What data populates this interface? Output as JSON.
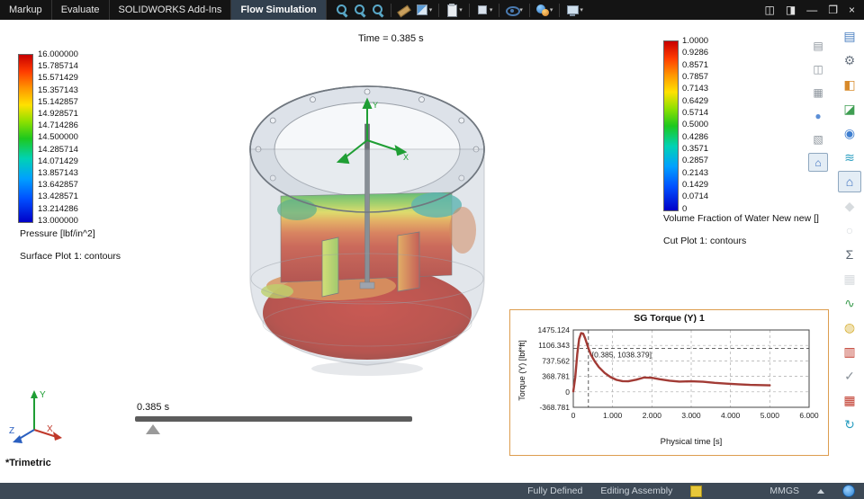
{
  "ribbon": {
    "tabs": [
      "Markup",
      "Evaluate",
      "SOLIDWORKS Add-Ins",
      "Flow Simulation"
    ],
    "active_tab": "Flow Simulation",
    "icons": [
      {
        "name": "zoom-to-fit-icon",
        "shape": "magnifier"
      },
      {
        "name": "zoom-to-area-icon",
        "shape": "magnifier"
      },
      {
        "name": "zoom-in-out-icon",
        "shape": "magnifier"
      },
      {
        "name": "sep"
      },
      {
        "name": "measure-icon",
        "shape": "ruler"
      },
      {
        "name": "section-view-icon",
        "shape": "section",
        "caret": true
      },
      {
        "name": "sep"
      },
      {
        "name": "evaluate-clipboard-icon",
        "shape": "clipboard",
        "caret": true
      },
      {
        "name": "sep"
      },
      {
        "name": "view-orientation-icon",
        "shape": "cube",
        "caret": true
      },
      {
        "name": "sep"
      },
      {
        "name": "hide-show-items-icon",
        "shape": "eye",
        "caret": true
      },
      {
        "name": "sep"
      },
      {
        "name": "edit-appearance-icon",
        "shape": "ball",
        "caret": true
      },
      {
        "name": "sep"
      },
      {
        "name": "view-settings-icon",
        "shape": "monitor",
        "caret": true
      }
    ]
  },
  "window_controls": {
    "icons": [
      {
        "name": "task-pane-toggle-icon",
        "glyph": "◫"
      },
      {
        "name": "display-pane-toggle-icon",
        "glyph": "◨"
      },
      {
        "name": "minimize-button",
        "glyph": "—"
      },
      {
        "name": "restore-button",
        "glyph": "❐"
      },
      {
        "name": "close-button",
        "glyph": "×"
      }
    ]
  },
  "viewport": {
    "time_label": "Time = 0.385 s",
    "orientation_label": "*Trimetric",
    "slider_label": "0.385 s"
  },
  "left_legend": {
    "title": "Pressure [lbf/in^2]",
    "subtitle": "Surface Plot 1: contours",
    "values": [
      "16.000000",
      "15.785714",
      "15.571429",
      "15.357143",
      "15.142857",
      "14.928571",
      "14.714286",
      "14.500000",
      "14.285714",
      "14.071429",
      "13.857143",
      "13.642857",
      "13.428571",
      "13.214286",
      "13.000000"
    ]
  },
  "right_legend": {
    "title": "Volume Fraction of Water New new []",
    "subtitle": "Cut Plot 1: contours",
    "values": [
      "1.0000",
      "0.9286",
      "0.8571",
      "0.7857",
      "0.7143",
      "0.6429",
      "0.5714",
      "0.5000",
      "0.4286",
      "0.3571",
      "0.2857",
      "0.2143",
      "0.1429",
      "0.0714",
      "0"
    ]
  },
  "chart_data": {
    "type": "line",
    "title": "SG Torque (Y) 1",
    "xlabel": "Physical time [s]",
    "ylabel": "Torque (Y) [lbf*ft]",
    "xlim": [
      0,
      6
    ],
    "ylim": [
      -368.781,
      1475.124
    ],
    "x_ticks": [
      "0",
      "1.000",
      "2.000",
      "3.000",
      "4.000",
      "5.000",
      "6.000"
    ],
    "x_tick_values": [
      0,
      1,
      2,
      3,
      4,
      5,
      6
    ],
    "y_ticks": [
      "1475.124",
      "1106.343",
      "737.562",
      "368.781",
      "0",
      "-368.781"
    ],
    "y_tick_values": [
      1475.124,
      1106.343,
      737.562,
      368.781,
      0,
      -368.781
    ],
    "grid": "dashed",
    "marker": {
      "x": 0.385,
      "y": 1038.379,
      "label": "[0.385, 1038.379]"
    },
    "series": [
      {
        "name": "SG Torque (Y)",
        "color": "#a23b35",
        "x": [
          0,
          0.05,
          0.1,
          0.15,
          0.2,
          0.25,
          0.3,
          0.385,
          0.45,
          0.55,
          0.65,
          0.8,
          0.95,
          1.1,
          1.25,
          1.4,
          1.6,
          1.8,
          2.0,
          2.2,
          2.45,
          2.7,
          3.0,
          3.3,
          3.6,
          3.9,
          4.2,
          4.5,
          4.75,
          5.0
        ],
        "y": [
          10,
          350,
          900,
          1260,
          1400,
          1390,
          1280,
          1038.379,
          880,
          720,
          590,
          450,
          350,
          285,
          255,
          250,
          290,
          340,
          335,
          300,
          265,
          245,
          250,
          240,
          215,
          195,
          180,
          165,
          160,
          155
        ]
      }
    ]
  },
  "right_toolbar": {
    "icons": [
      {
        "name": "batch-results-icon",
        "glyph": "▤",
        "color": "#4a7fc0"
      },
      {
        "name": "component-control-icon",
        "glyph": "⚙",
        "color": "#6e7884"
      },
      {
        "name": "cut-plot-icon",
        "glyph": "◧",
        "color": "#d88a2a"
      },
      {
        "name": "surface-plot-icon",
        "glyph": "◪",
        "color": "#3f9e52"
      },
      {
        "name": "isosurfaces-icon",
        "glyph": "◉",
        "color": "#3f7fd0"
      },
      {
        "name": "flow-trajectories-icon",
        "glyph": "≋",
        "color": "#2a9ec0"
      },
      {
        "name": "home-view-icon",
        "glyph": "⌂",
        "color": "#3a6fbf",
        "active": true
      },
      {
        "name": "particle-study-icon",
        "glyph": "◆",
        "color": "#a8b0b8",
        "disabled": true
      },
      {
        "name": "point-parameters-icon",
        "glyph": "○",
        "color": "#a8b0b8",
        "disabled": true
      },
      {
        "name": "surface-parameters-icon",
        "glyph": "Σ",
        "color": "#5a6470"
      },
      {
        "name": "volume-parameters-icon",
        "glyph": "▦",
        "color": "#a8b0b8",
        "disabled": true
      },
      {
        "name": "xy-plot-icon",
        "glyph": "∿",
        "color": "#3f9e52"
      },
      {
        "name": "goal-plot-icon",
        "glyph": "◍",
        "color": "#d8b23a"
      },
      {
        "name": "report-icon",
        "glyph": "▥",
        "color": "#c0392b"
      },
      {
        "name": "check-results-icon",
        "glyph": "✓",
        "color": "#8a929a"
      },
      {
        "name": "mesh-display-icon",
        "glyph": "▦",
        "color": "#c0392b"
      },
      {
        "name": "refresh-results-icon",
        "glyph": "↻",
        "color": "#2a9ec0"
      }
    ]
  },
  "side_panel": {
    "icons": [
      {
        "name": "design-library-icon",
        "glyph": "▤",
        "color": "#8a929a"
      },
      {
        "name": "file-explorer-icon",
        "glyph": "◫",
        "color": "#8a929a"
      },
      {
        "name": "view-palette-icon",
        "glyph": "▦",
        "color": "#8a929a"
      },
      {
        "name": "appearances-scenes-icon",
        "glyph": "●",
        "color": "#5b8ed6"
      },
      {
        "name": "custom-properties-icon",
        "glyph": "▧",
        "color": "#8a929a"
      },
      {
        "name": "home-panel-icon",
        "glyph": "⌂",
        "color": "#3a6fbf",
        "active": true
      }
    ]
  },
  "status_bar": {
    "definition": "Fully Defined",
    "mode": "Editing Assembly",
    "units": "MMGS"
  }
}
